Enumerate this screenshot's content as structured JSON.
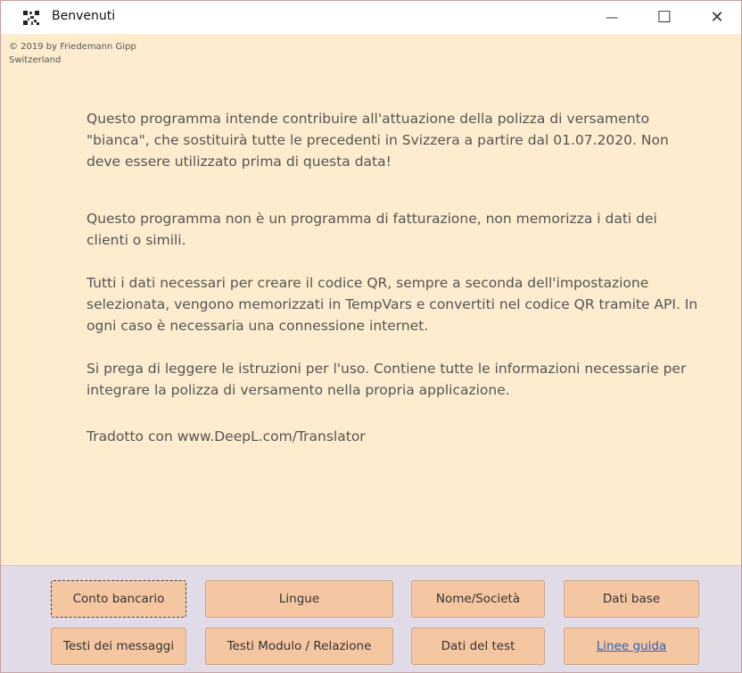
{
  "window": {
    "title": "Benvenuti",
    "controls": {
      "minimize": "—",
      "maximize": "☐",
      "close": "✕"
    }
  },
  "header": {
    "copyright": "© 2019 by Friedemann Gipp",
    "location": "Switzerland"
  },
  "content": {
    "paragraphs": [
      "Questo programma intende contribuire all'attuazione della polizza di versamento \"bianca\", che sostituirà tutte le precedenti in Svizzera a partire dal 01.07.2020. Non deve essere utilizzato prima di questa data!",
      "Questo programma non è un programma di fatturazione, non memorizza i dati dei clienti o simili.",
      "Tutti i dati necessari per creare il codice QR, sempre a seconda dell'impostazione selezionata, vengono memorizzati in TempVars e convertiti nel codice QR tramite API. In ogni caso è necessaria una connessione internet.",
      "Si prega di leggere le istruzioni per l'uso. Contiene tutte le informazioni necessarie per integrare la polizza di versamento nella propria applicazione.",
      "Tradotto con www.DeepL.com/Translator"
    ]
  },
  "buttons": {
    "conto_bancario": "Conto bancario",
    "lingue": "Lingue",
    "nome_societa": "Nome/Società",
    "dati_base": "Dati base",
    "testi_messaggi": "Testi dei messaggi",
    "testi_modulo": "Testi Modulo / Relazione",
    "dati_test": "Dati del test",
    "linee_guida": "Linee guida"
  },
  "colors": {
    "background": "#fdeccd",
    "footer": "#e1dbe7",
    "button": "#f5c6a2",
    "text": "#555555",
    "link": "#2f5fb3"
  }
}
